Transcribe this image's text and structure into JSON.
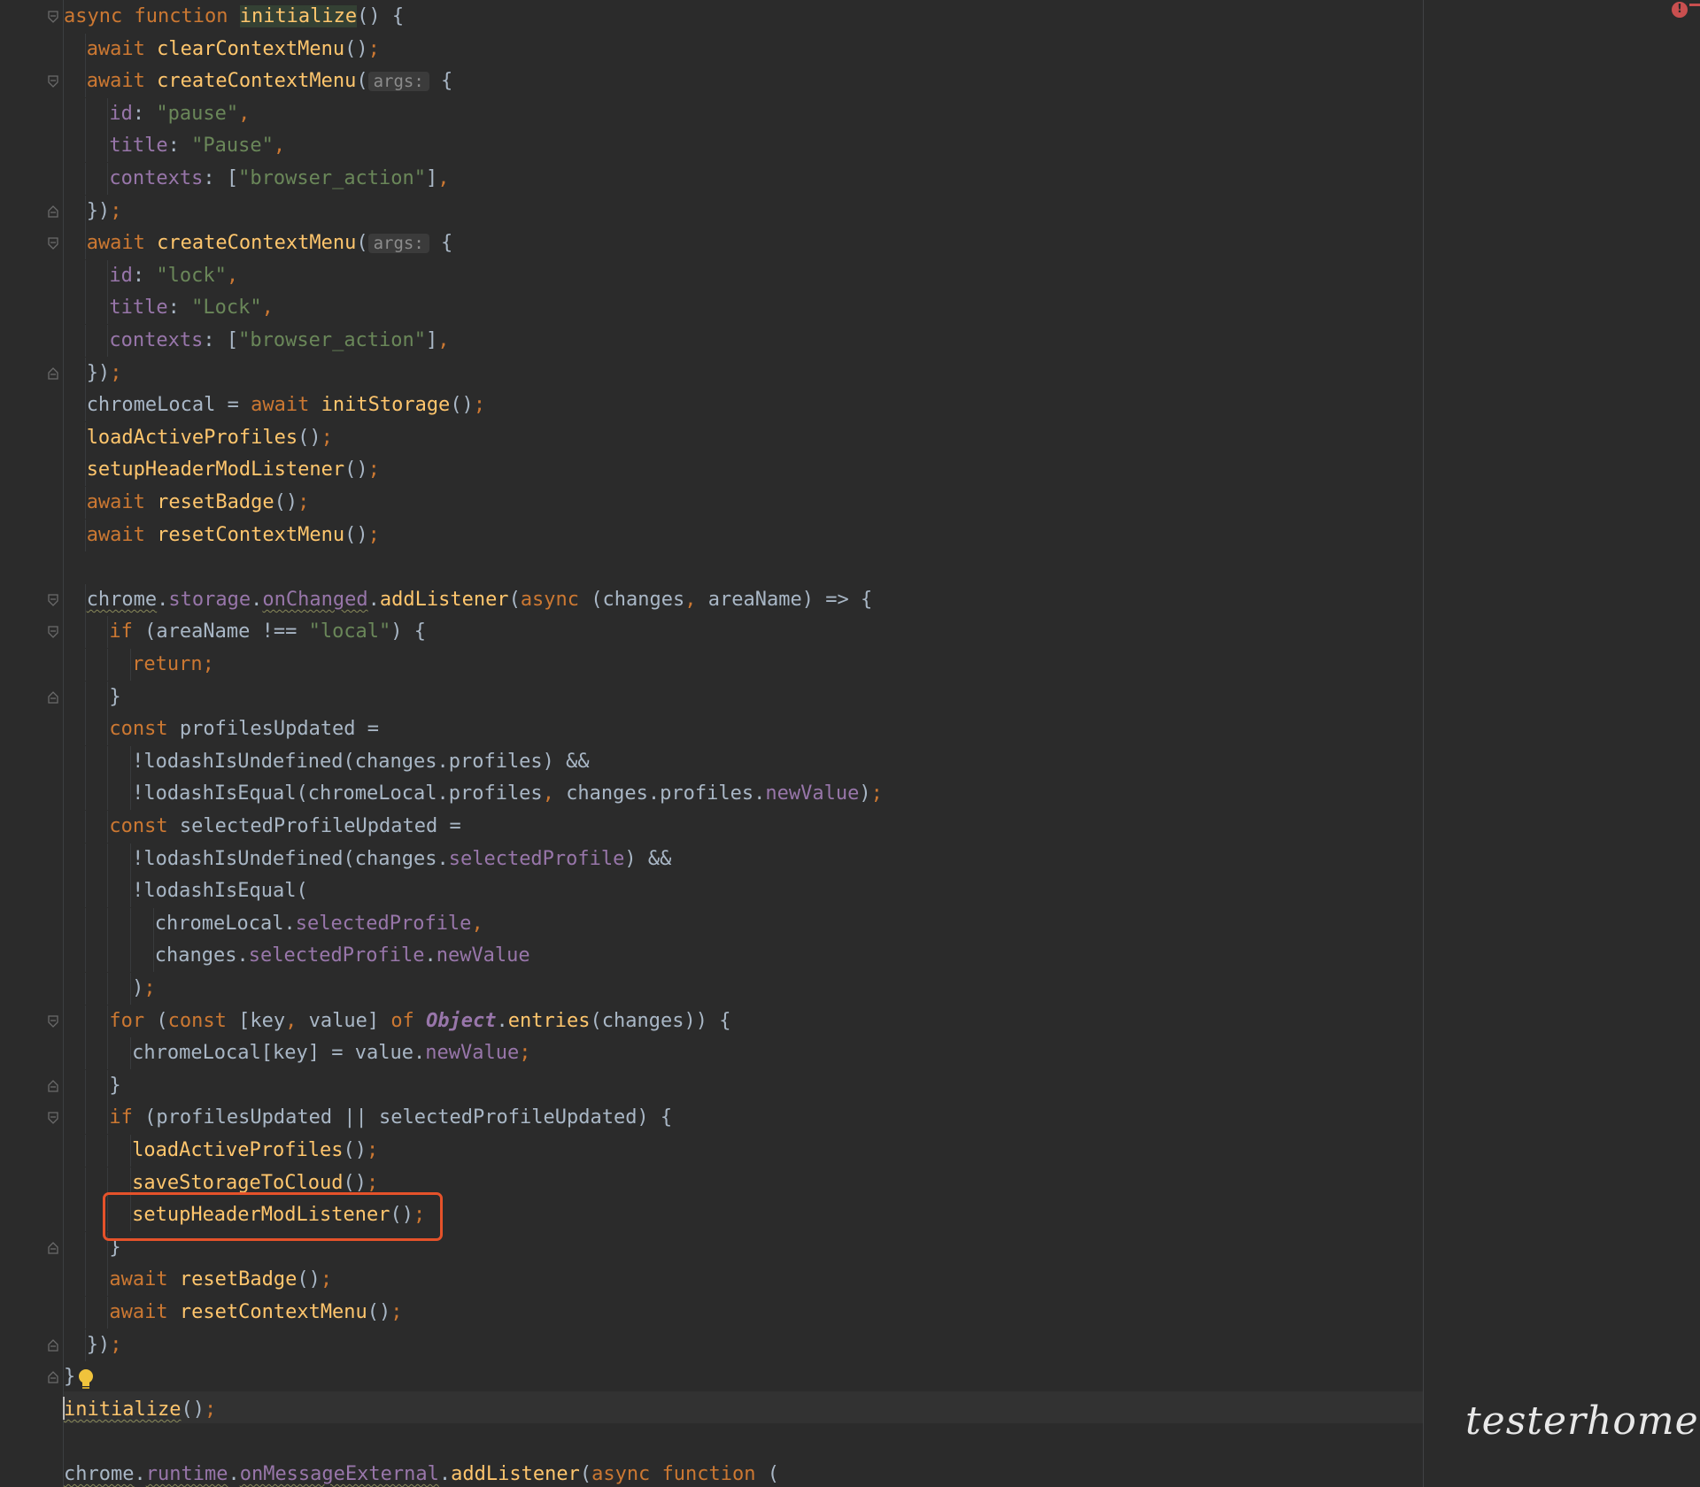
{
  "editor": {
    "inlay_hint": "args:",
    "watermark": "testerhome.com",
    "error_badge": "!",
    "lines": [
      [
        [
          "kw",
          "async "
        ],
        [
          "kw",
          "function "
        ],
        [
          "fn-hl",
          "initialize"
        ],
        [
          "pun",
          "() {"
        ]
      ],
      [
        [
          "kw",
          "await "
        ],
        [
          "fn",
          "clearContextMenu"
        ],
        [
          "pun",
          "()"
        ],
        [
          "semi",
          ";"
        ]
      ],
      [
        [
          "kw",
          "await "
        ],
        [
          "fn",
          "createContextMenu"
        ],
        [
          "pun",
          "("
        ],
        [
          "hint",
          "args:"
        ],
        [
          "pun",
          " {"
        ]
      ],
      [
        [
          "prop",
          "id"
        ],
        [
          "pun",
          ": "
        ],
        [
          "str",
          "\"pause\""
        ],
        [
          "semi",
          ","
        ]
      ],
      [
        [
          "prop",
          "title"
        ],
        [
          "pun",
          ": "
        ],
        [
          "str",
          "\"Pause\""
        ],
        [
          "semi",
          ","
        ]
      ],
      [
        [
          "prop",
          "contexts"
        ],
        [
          "pun",
          ": ["
        ],
        [
          "str",
          "\"browser_action\""
        ],
        [
          "pun",
          "]"
        ],
        [
          "semi",
          ","
        ]
      ],
      [
        [
          "pun",
          "})"
        ],
        [
          "semi",
          ";"
        ]
      ],
      [
        [
          "kw",
          "await "
        ],
        [
          "fn",
          "createContextMenu"
        ],
        [
          "pun",
          "("
        ],
        [
          "hint",
          "args:"
        ],
        [
          "pun",
          " {"
        ]
      ],
      [
        [
          "prop",
          "id"
        ],
        [
          "pun",
          ": "
        ],
        [
          "str",
          "\"lock\""
        ],
        [
          "semi",
          ","
        ]
      ],
      [
        [
          "prop",
          "title"
        ],
        [
          "pun",
          ": "
        ],
        [
          "str",
          "\"Lock\""
        ],
        [
          "semi",
          ","
        ]
      ],
      [
        [
          "prop",
          "contexts"
        ],
        [
          "pun",
          ": ["
        ],
        [
          "str",
          "\"browser_action\""
        ],
        [
          "pun",
          "]"
        ],
        [
          "semi",
          ","
        ]
      ],
      [
        [
          "pun",
          "})"
        ],
        [
          "semi",
          ";"
        ]
      ],
      [
        [
          "def",
          "chromeLocal = "
        ],
        [
          "kw",
          "await "
        ],
        [
          "fn",
          "initStorage"
        ],
        [
          "pun",
          "()"
        ],
        [
          "semi",
          ";"
        ]
      ],
      [
        [
          "fn",
          "loadActiveProfiles"
        ],
        [
          "pun",
          "()"
        ],
        [
          "semi",
          ";"
        ]
      ],
      [
        [
          "fn",
          "setupHeaderModListener"
        ],
        [
          "pun",
          "()"
        ],
        [
          "semi",
          ";"
        ]
      ],
      [
        [
          "kw",
          "await "
        ],
        [
          "fn",
          "resetBadge"
        ],
        [
          "pun",
          "()"
        ],
        [
          "semi",
          ";"
        ]
      ],
      [
        [
          "kw",
          "await "
        ],
        [
          "fn",
          "resetContextMenu"
        ],
        [
          "pun",
          "()"
        ],
        [
          "semi",
          ";"
        ]
      ],
      [],
      [
        [
          "def-wavy",
          "chrome"
        ],
        [
          "pun",
          "."
        ],
        [
          "prop",
          "storage"
        ],
        [
          "pun",
          "."
        ],
        [
          "prop-wavy",
          "onChanged"
        ],
        [
          "pun",
          "."
        ],
        [
          "fn",
          "addListener"
        ],
        [
          "pun",
          "("
        ],
        [
          "kw",
          "async "
        ],
        [
          "pun",
          "(changes"
        ],
        [
          "semi",
          ", "
        ],
        [
          "pun",
          "areaName) => {"
        ]
      ],
      [
        [
          "kw",
          "if "
        ],
        [
          "pun",
          "(areaName !== "
        ],
        [
          "str",
          "\"local\""
        ],
        [
          "pun",
          ") {"
        ]
      ],
      [
        [
          "kw",
          "return"
        ],
        [
          "semi",
          ";"
        ]
      ],
      [
        [
          "pun",
          "}"
        ]
      ],
      [
        [
          "kw",
          "const "
        ],
        [
          "def",
          "profilesUpdated ="
        ]
      ],
      [
        [
          "def",
          "!lodashIsUndefined(changes.profiles) &&"
        ]
      ],
      [
        [
          "def",
          "!lodashIsEqual(chromeLocal.profiles"
        ],
        [
          "semi",
          ", "
        ],
        [
          "def",
          "changes.profiles."
        ],
        [
          "prop",
          "newValue"
        ],
        [
          "pun",
          ")"
        ],
        [
          "semi",
          ";"
        ]
      ],
      [
        [
          "kw",
          "const "
        ],
        [
          "def",
          "selectedProfileUpdated ="
        ]
      ],
      [
        [
          "def",
          "!lodashIsUndefined(changes."
        ],
        [
          "prop",
          "selectedProfile"
        ],
        [
          "def",
          ") &&"
        ]
      ],
      [
        [
          "def",
          "!lodashIsEqual("
        ]
      ],
      [
        [
          "def",
          "chromeLocal."
        ],
        [
          "prop",
          "selectedProfile"
        ],
        [
          "semi",
          ","
        ]
      ],
      [
        [
          "def",
          "changes."
        ],
        [
          "prop",
          "selectedProfile"
        ],
        [
          "def",
          "."
        ],
        [
          "prop",
          "newValue"
        ]
      ],
      [
        [
          "pun",
          ")"
        ],
        [
          "semi",
          ";"
        ]
      ],
      [
        [
          "kw",
          "for "
        ],
        [
          "pun",
          "("
        ],
        [
          "kw",
          "const "
        ],
        [
          "pun",
          "[key"
        ],
        [
          "semi",
          ", "
        ],
        [
          "pun",
          "value] "
        ],
        [
          "kw",
          "of "
        ],
        [
          "obj",
          "Object"
        ],
        [
          "pun",
          "."
        ],
        [
          "fn",
          "entries"
        ],
        [
          "pun",
          "(changes)) {"
        ]
      ],
      [
        [
          "def",
          "chromeLocal[key] = value."
        ],
        [
          "prop",
          "newValue"
        ],
        [
          "semi",
          ";"
        ]
      ],
      [
        [
          "pun",
          "}"
        ]
      ],
      [
        [
          "kw",
          "if "
        ],
        [
          "pun",
          "(profilesUpdated || selectedProfileUpdated) {"
        ]
      ],
      [
        [
          "fn",
          "loadActiveProfiles"
        ],
        [
          "pun",
          "()"
        ],
        [
          "semi",
          ";"
        ]
      ],
      [
        [
          "fn",
          "saveStorageToCloud"
        ],
        [
          "pun",
          "()"
        ],
        [
          "semi",
          ";"
        ]
      ],
      [
        [
          "fn",
          "setupHeaderModListener"
        ],
        [
          "pun",
          "()"
        ],
        [
          "semi",
          ";"
        ]
      ],
      [
        [
          "pun",
          "}"
        ]
      ],
      [
        [
          "kw",
          "await "
        ],
        [
          "fn",
          "resetBadge"
        ],
        [
          "pun",
          "()"
        ],
        [
          "semi",
          ";"
        ]
      ],
      [
        [
          "kw",
          "await "
        ],
        [
          "fn",
          "resetContextMenu"
        ],
        [
          "pun",
          "()"
        ],
        [
          "semi",
          ";"
        ]
      ],
      [
        [
          "pun",
          "})"
        ],
        [
          "semi",
          ";"
        ]
      ],
      [
        [
          "pun",
          "}"
        ]
      ],
      [
        [
          "fn-wavy",
          "initialize"
        ],
        [
          "pun",
          "()"
        ],
        [
          "semi",
          ";"
        ]
      ],
      [],
      [
        [
          "def-wavy",
          "chrome"
        ],
        [
          "pun",
          "."
        ],
        [
          "prop-wavy",
          "runtime"
        ],
        [
          "pun",
          "."
        ],
        [
          "prop-wavy",
          "onMessageExternal"
        ],
        [
          "pun",
          "."
        ],
        [
          "fn",
          "addListener"
        ],
        [
          "pun",
          "("
        ],
        [
          "kw",
          "async "
        ],
        [
          "kw",
          "function "
        ],
        [
          "pun",
          "("
        ]
      ]
    ]
  }
}
